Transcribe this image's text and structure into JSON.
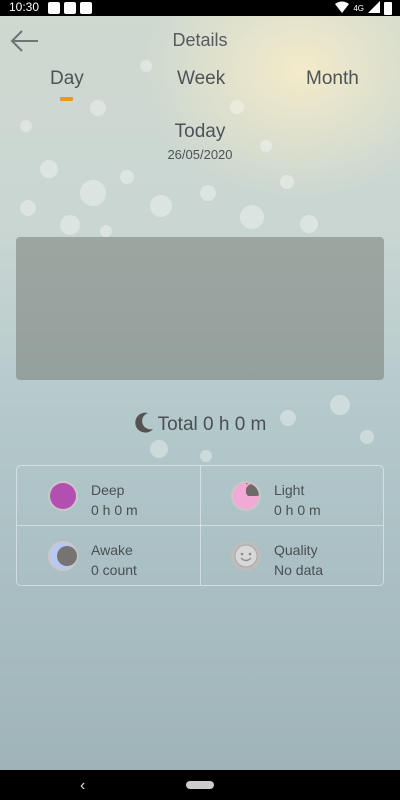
{
  "status_bar": {
    "time": "10:30",
    "network": "4G"
  },
  "header": {
    "title": "Details"
  },
  "tabs": [
    {
      "label": "Day",
      "selected": true
    },
    {
      "label": "Week",
      "selected": false
    },
    {
      "label": "Month",
      "selected": false
    }
  ],
  "date": {
    "title": "Today",
    "value": "26/05/2020"
  },
  "total": {
    "text": "Total 0 h 0 m"
  },
  "stats": [
    {
      "label": "Deep",
      "value": "0 h 0 m",
      "icon": "deep-sleep-icon",
      "color": "#b24fb0"
    },
    {
      "label": "Light",
      "value": "0 h 0 m",
      "icon": "light-sleep-icon",
      "color": "#f3a9d5"
    },
    {
      "label": "Awake",
      "value": "0 count",
      "icon": "awake-icon",
      "color": "#b8c8f5"
    },
    {
      "label": "Quality",
      "value": "No data",
      "icon": "quality-smiley-icon",
      "color": "#c9c9c9"
    }
  ],
  "colors": {
    "accent": "#f0941e"
  }
}
